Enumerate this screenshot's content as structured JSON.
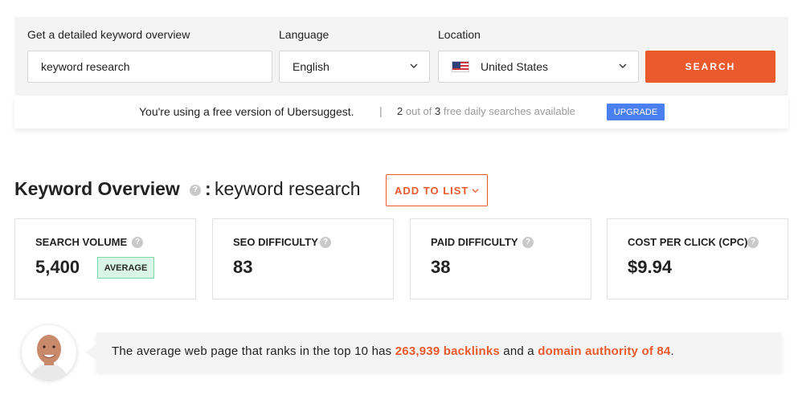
{
  "search_form": {
    "keyword_label": "Get a detailed keyword overview",
    "keyword_value": "keyword research",
    "language_label": "Language",
    "language_value": "English",
    "location_label": "Location",
    "location_value": "United States",
    "search_button": "SEARCH"
  },
  "free_notice": {
    "message": "You're using a free version of Ubersuggest.",
    "separator": "|",
    "used": "2",
    "out_of": "out of",
    "limit": "3",
    "suffix": "free daily searches available",
    "upgrade_button": "UPGRADE"
  },
  "overview": {
    "title": "Keyword Overview",
    "colon": ":",
    "keyword": "keyword research",
    "add_to_list": "ADD TO LIST"
  },
  "metrics": [
    {
      "label": "SEARCH VOLUME",
      "value": "5,400",
      "badge": "AVERAGE"
    },
    {
      "label": "SEO DIFFICULTY",
      "value": "83"
    },
    {
      "label": "PAID DIFFICULTY",
      "value": "38"
    },
    {
      "label": "COST PER CLICK (CPC)",
      "value": "$9.94"
    }
  ],
  "insight": {
    "prefix": "The average web page that ranks in the top 10 has",
    "backlinks": "263,939 backlinks",
    "middle": "and a",
    "authority": "domain authority of 84",
    "suffix": "."
  },
  "icons": {
    "help": "question-mark-icon",
    "dropdown": "chevron-down-icon",
    "flag": "us-flag-icon",
    "avatar": "user-avatar"
  },
  "colors": {
    "accent": "#ea5a2d",
    "upgrade": "#4a7ff0",
    "badge_bg": "#d8f5e6",
    "panel_bg": "#f4f4f4"
  }
}
